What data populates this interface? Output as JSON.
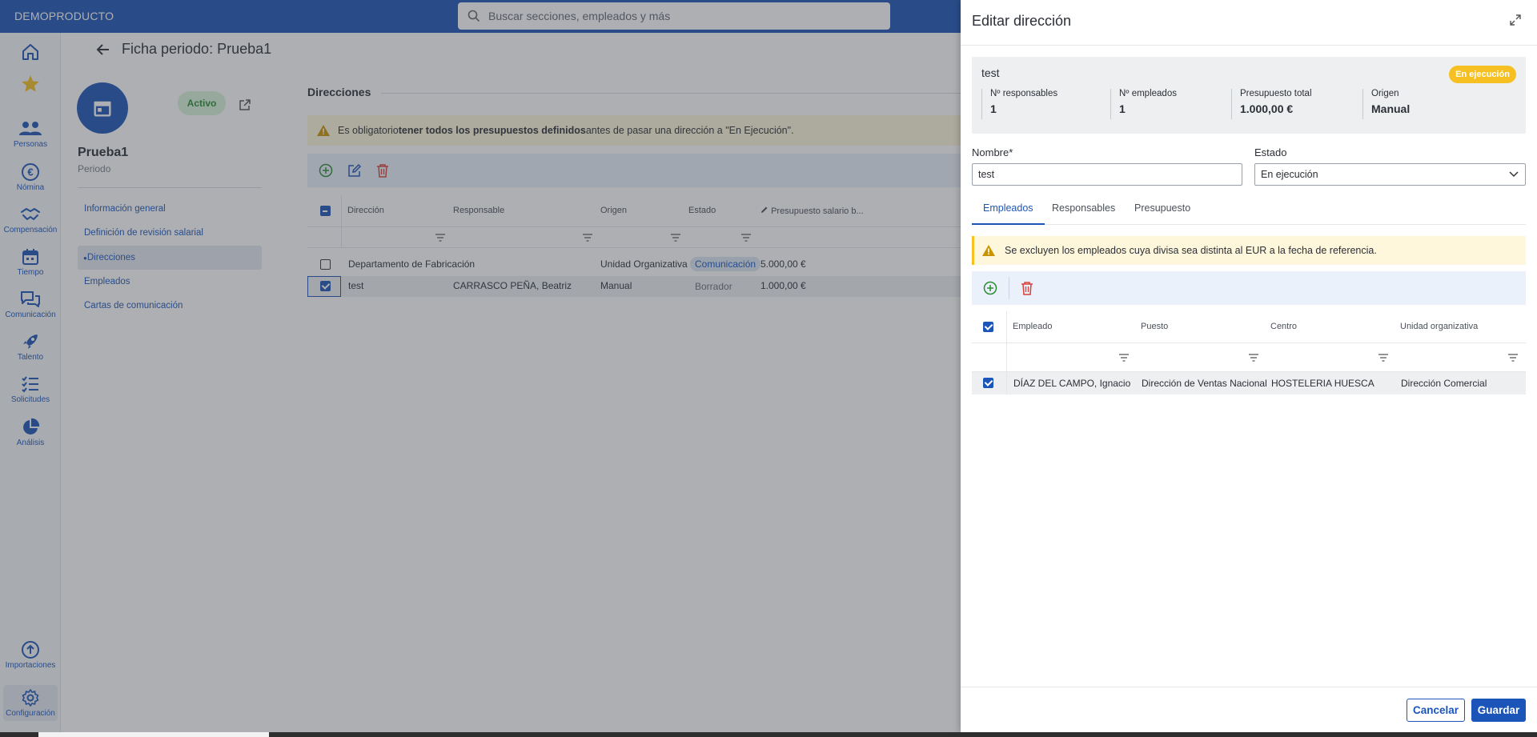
{
  "topbar": {
    "brand": "DEMOPRODUCTO",
    "search_placeholder": "Buscar secciones, empleados y más"
  },
  "nav": {
    "personas": "Personas",
    "nomina": "Nómina",
    "compensacion": "Compensación",
    "tiempo": "Tiempo",
    "comunicacion": "Comunicación",
    "talento": "Talento",
    "solicitudes": "Solicitudes",
    "analisis": "Análisis",
    "importaciones": "Importaciones",
    "configuracion": "Configuración"
  },
  "page": {
    "title": "Ficha periodo: Prueba1",
    "status": "Activo",
    "name": "Prueba1",
    "subtitle": "Periodo",
    "menu": [
      "Información general",
      "Definición de revisión salarial",
      "Direcciones",
      "Empleados",
      "Cartas de comunicación"
    ],
    "section_title": "Direcciones",
    "warning_pre": "Es obligatorio ",
    "warning_bold": "tener todos los presupuestos definidos",
    "warning_post": " antes de pasar una dirección a \"En Ejecución\".",
    "columns": [
      "Dirección",
      "Responsable",
      "Origen",
      "Estado",
      "Presupuesto salario b..."
    ],
    "rows": [
      {
        "direccion": "Departamento de Fabricación",
        "responsable": "",
        "origen": "Unidad Organizativa",
        "estado": "Comunicación",
        "presupuesto": "5.000,00 €",
        "checked": false
      },
      {
        "direccion": "test",
        "responsable": "CARRASCO PEÑA, Beatriz",
        "origen": "Manual",
        "estado": "Borrador",
        "presupuesto": "1.000,00 €",
        "checked": true
      }
    ]
  },
  "drawer": {
    "title": "Editar dirección",
    "summary": {
      "name": "test",
      "badge": "En ejecución",
      "stats": [
        {
          "label": "Nº responsables",
          "value": "1"
        },
        {
          "label": "Nº empleados",
          "value": "1"
        },
        {
          "label": "Presupuesto total",
          "value": "1.000,00 €"
        },
        {
          "label": "Origen",
          "value": "Manual"
        }
      ]
    },
    "nombre_label": "Nombre*",
    "nombre_value": "test",
    "estado_label": "Estado",
    "estado_value": "En ejecución",
    "tabs": [
      "Empleados",
      "Responsables",
      "Presupuesto"
    ],
    "warning": "Se excluyen los empleados cuya divisa sea distinta al EUR a la fecha de referencia.",
    "columns": [
      "Empleado",
      "Puesto",
      "Centro",
      "Unidad organizativa"
    ],
    "rows": [
      {
        "empleado": "DÍAZ DEL CAMPO, Ignacio",
        "puesto": "Dirección de Ventas Nacional",
        "centro": "HOSTELERIA HUESCA",
        "unidad": "Dirección Comercial"
      }
    ],
    "cancel": "Cancelar",
    "save": "Guardar"
  },
  "colors": {
    "primary": "#1c55b9",
    "warning": "#f6c022",
    "success": "#2c8b35",
    "danger": "#d9403a"
  }
}
